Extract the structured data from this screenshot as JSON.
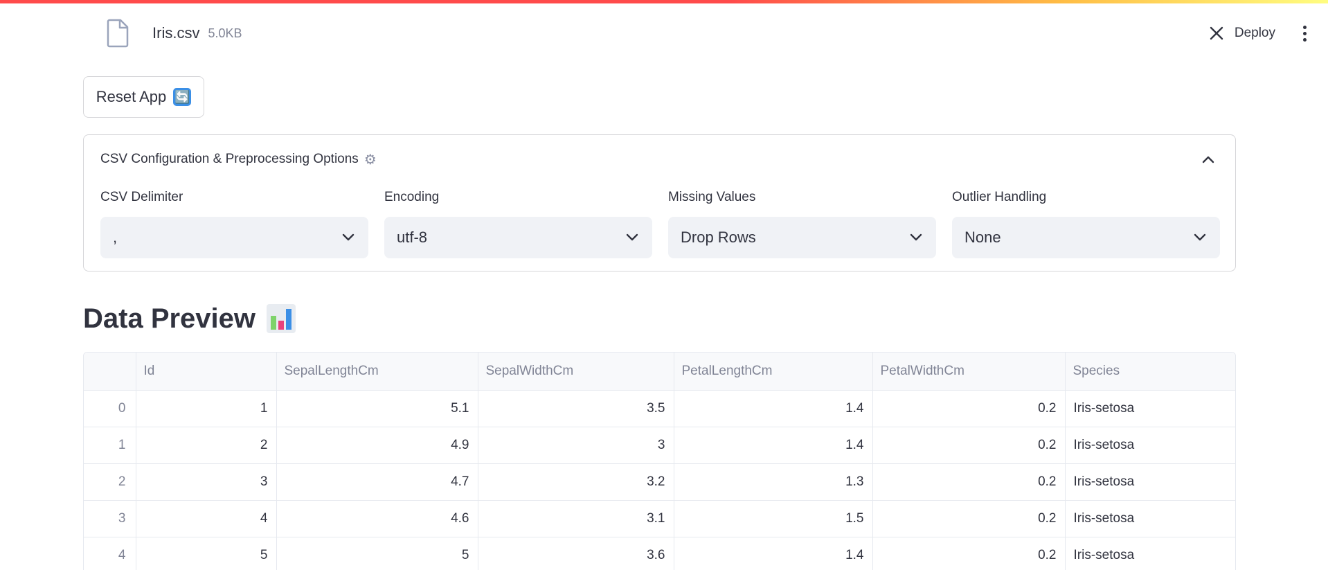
{
  "file": {
    "name": "Iris.csv",
    "size": "5.0KB"
  },
  "header": {
    "deploy_label": "Deploy"
  },
  "reset_button": {
    "label": "Reset App",
    "emoji": "🔄"
  },
  "expander": {
    "title": "CSV Configuration & Preprocessing Options",
    "icon": "gear-icon",
    "fields": [
      {
        "label": "CSV Delimiter",
        "value": ","
      },
      {
        "label": "Encoding",
        "value": "utf-8"
      },
      {
        "label": "Missing Values",
        "value": "Drop Rows"
      },
      {
        "label": "Outlier Handling",
        "value": "None"
      }
    ]
  },
  "preview": {
    "title": "Data Preview",
    "icon": "bar-chart-icon"
  },
  "table": {
    "columns": [
      "",
      "Id",
      "SepalLengthCm",
      "SepalWidthCm",
      "PetalLengthCm",
      "PetalWidthCm",
      "Species"
    ],
    "rows": [
      [
        "0",
        "1",
        "5.1",
        "3.5",
        "1.4",
        "0.2",
        "Iris-setosa"
      ],
      [
        "1",
        "2",
        "4.9",
        "3",
        "1.4",
        "0.2",
        "Iris-setosa"
      ],
      [
        "2",
        "3",
        "4.7",
        "3.2",
        "1.3",
        "0.2",
        "Iris-setosa"
      ],
      [
        "3",
        "4",
        "4.6",
        "3.1",
        "1.5",
        "0.2",
        "Iris-setosa"
      ],
      [
        "4",
        "5",
        "5",
        "3.6",
        "1.4",
        "0.2",
        "Iris-setosa"
      ]
    ]
  },
  "colors": {
    "accent": "#ff4b4b",
    "select_bg": "#f0f2f6",
    "muted_text": "#808495"
  }
}
